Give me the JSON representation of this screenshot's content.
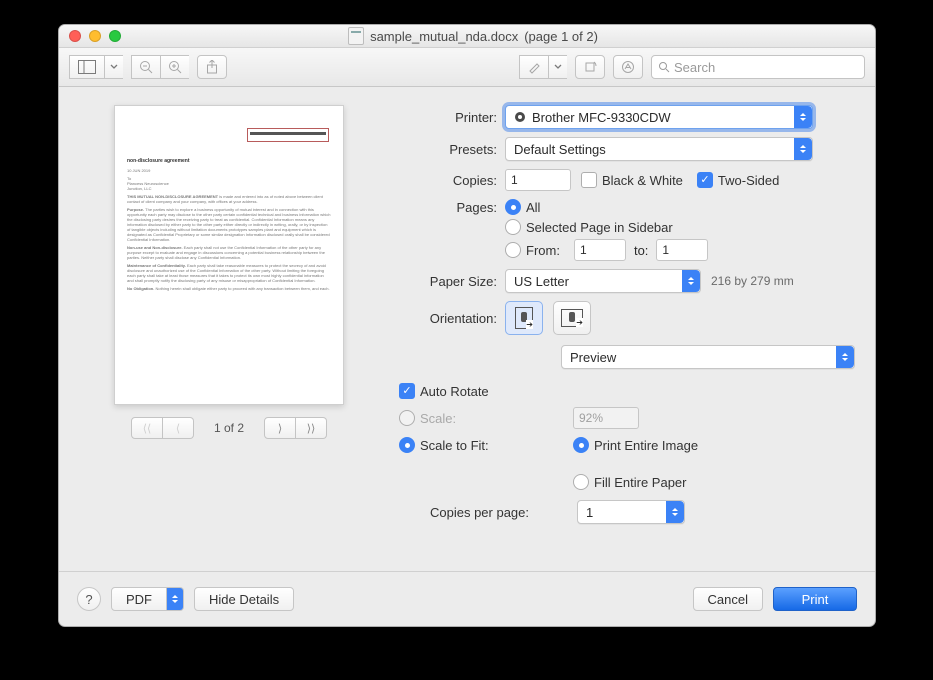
{
  "titlebar": {
    "filename": "sample_mutual_nda.docx",
    "page_info": "(page 1 of 2)"
  },
  "toolbar": {
    "search_placeholder": "Search"
  },
  "preview": {
    "page_status": "1 of 2"
  },
  "form": {
    "printer_label": "Printer:",
    "printer_value": "Brother MFC-9330CDW",
    "presets_label": "Presets:",
    "presets_value": "Default Settings",
    "copies_label": "Copies:",
    "copies_value": "1",
    "bw_label": "Black & White",
    "twosided_label": "Two-Sided",
    "pages_label": "Pages:",
    "pages_all": "All",
    "pages_selected": "Selected Page in Sidebar",
    "pages_from": "From:",
    "pages_from_val": "1",
    "pages_to": "to:",
    "pages_to_val": "1",
    "papersize_label": "Paper Size:",
    "papersize_value": "US Letter",
    "papersize_dim": "216 by 279 mm",
    "orientation_label": "Orientation:",
    "section_value": "Preview",
    "autorotate_label": "Auto Rotate",
    "scale_label": "Scale:",
    "scale_value": "92%",
    "scalefit_label": "Scale to Fit:",
    "print_entire": "Print Entire Image",
    "fill_paper": "Fill Entire Paper",
    "copies_per_page_label": "Copies per page:",
    "copies_per_page_value": "1"
  },
  "buttons": {
    "help": "?",
    "pdf": "PDF",
    "hide_details": "Hide Details",
    "cancel": "Cancel",
    "print": "Print"
  }
}
